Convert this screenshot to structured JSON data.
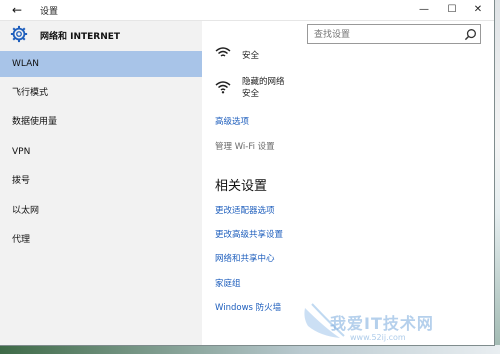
{
  "window": {
    "title": "设置",
    "back_glyph": "←",
    "minimize_glyph": "—",
    "maximize_glyph": "☐",
    "close_glyph": "✕"
  },
  "sidebar": {
    "title": "网络和 INTERNET",
    "items": [
      {
        "label": "WLAN",
        "active": true
      },
      {
        "label": "飞行模式"
      },
      {
        "label": "数据使用量"
      },
      {
        "label": "VPN"
      },
      {
        "label": "拨号"
      },
      {
        "label": "以太网"
      },
      {
        "label": "代理"
      }
    ]
  },
  "search": {
    "placeholder": "查找设置"
  },
  "networks": [
    {
      "name": "",
      "status": "安全"
    },
    {
      "name": "隐藏的网络",
      "status": "安全"
    }
  ],
  "links": {
    "advanced": "高级选项",
    "manage_wifi": "管理 Wi-Fi 设置"
  },
  "related": {
    "title": "相关设置",
    "items": [
      "更改适配器选项",
      "更改高级共享设置",
      "网络和共享中心",
      "家庭组",
      "Windows 防火墙"
    ]
  },
  "watermark": {
    "text": "我爱IT技术网",
    "url": "www.52ij.com"
  },
  "colors": {
    "accent": "#1f5fbd",
    "active_item": "#a8c4e8",
    "sidebar_bg": "#f2f2f2"
  }
}
